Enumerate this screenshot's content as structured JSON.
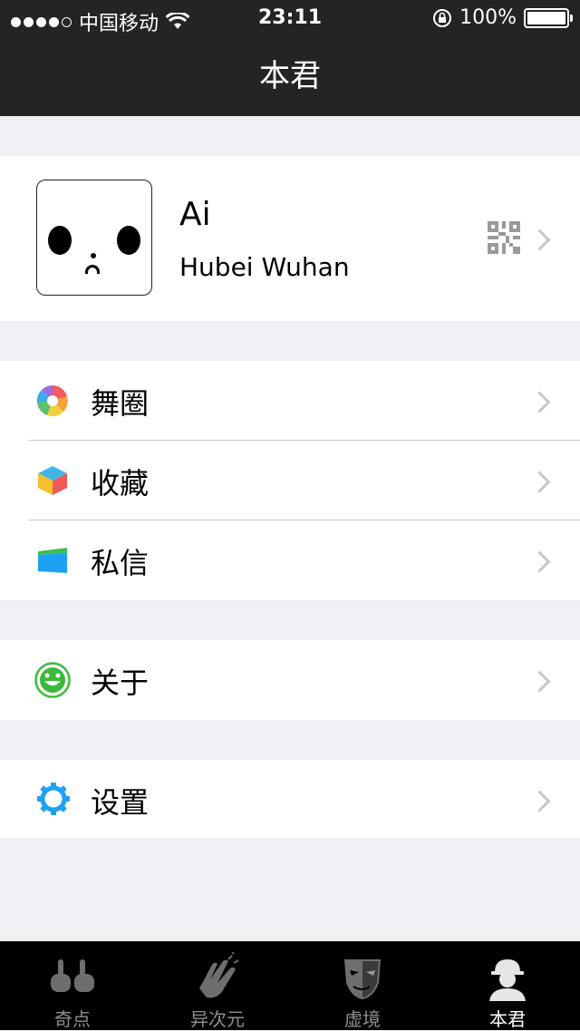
{
  "status": {
    "carrier": "中国移动",
    "time": "23:11",
    "battery": "100%"
  },
  "nav": {
    "title": "本君"
  },
  "profile": {
    "name": "Ai",
    "location": "Hubei Wuhan"
  },
  "menu": {
    "group1": [
      {
        "label": "舞圈",
        "icon": "aperture-icon"
      },
      {
        "label": "收藏",
        "icon": "cube-icon"
      },
      {
        "label": "私信",
        "icon": "card-icon"
      }
    ],
    "about": {
      "label": "关于",
      "icon": "smile-icon"
    },
    "settings": {
      "label": "设置",
      "icon": "gear-icon"
    }
  },
  "tabs": [
    {
      "label": "奇点",
      "icon": "hands-icon"
    },
    {
      "label": "异次元",
      "icon": "clap-icon"
    },
    {
      "label": "虚境",
      "icon": "mask-icon"
    },
    {
      "label": "本君",
      "icon": "worker-icon",
      "active": true
    }
  ],
  "colors": {
    "bar": "#242424",
    "accent_blue": "#1da1f2",
    "accent_green": "#3cb93c"
  }
}
